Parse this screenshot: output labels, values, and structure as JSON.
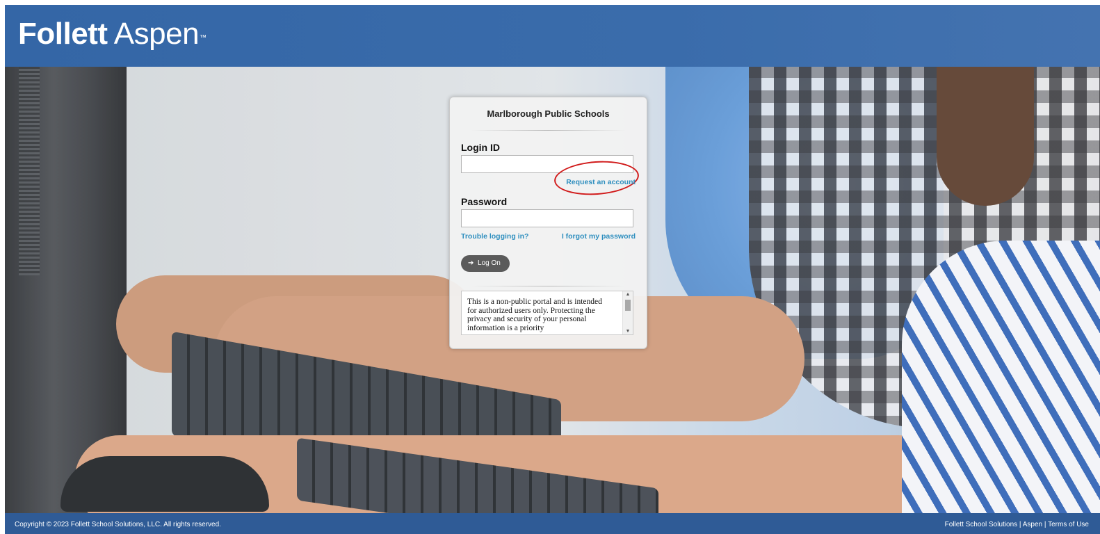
{
  "header": {
    "logo_bold": "Follett",
    "logo_light": "Aspen",
    "logo_tm": "™",
    "background_color": "#3466a6"
  },
  "login": {
    "school_name": "Marlborough Public Schools",
    "login_id_label": "Login ID",
    "login_id_value": "",
    "request_account_link": "Request an account",
    "password_label": "Password",
    "password_value": "",
    "trouble_link": "Trouble logging in?",
    "forgot_password_link": "I forgot my password",
    "logon_button": "Log On",
    "logon_icon": "sign-in-icon",
    "annotation_color": "#d11b1b",
    "link_color": "#2f8fbf",
    "notice_text": "This is a non-public portal and is intended for authorized users only. Protecting the privacy and security of your personal information is a priority"
  },
  "footer": {
    "copyright": "Copyright © 2023 Follett School Solutions, LLC. All rights reserved.",
    "link_follett": "Follett School Solutions",
    "separator": " | ",
    "link_aspen": "Aspen",
    "link_terms": "Terms of Use"
  }
}
